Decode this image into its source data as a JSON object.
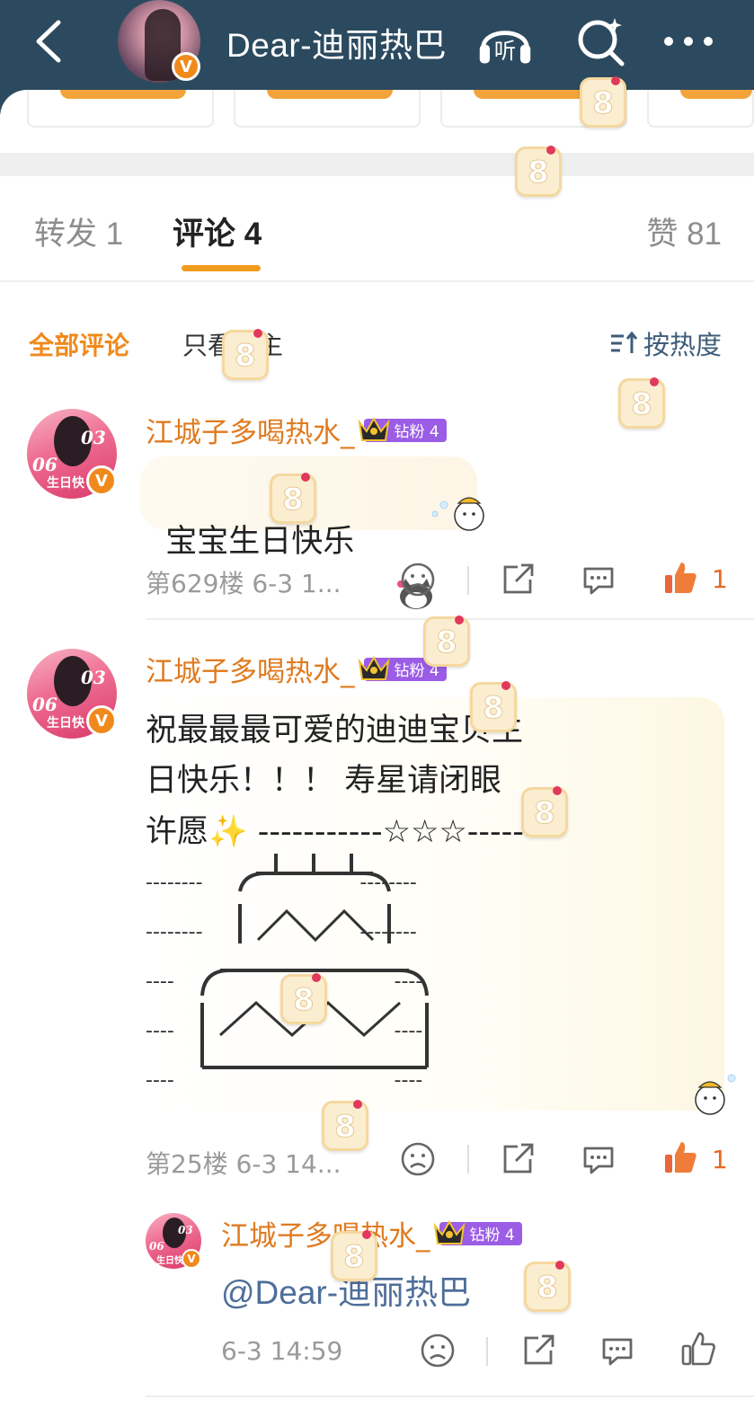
{
  "header": {
    "title": "Dear-迪丽热巴",
    "listen_label": "听"
  },
  "tabs": {
    "repost": "转发 1",
    "comment": "评论 4",
    "likes": "赞 81"
  },
  "filter": {
    "all": "全部评论",
    "op_only": "只看博主",
    "sort": "按热度"
  },
  "comments": [
    {
      "username": "江城子多喝热水_",
      "badge": "钻粉 4",
      "text": "宝宝生日快乐",
      "floor_time": "第629楼  6-3 1...",
      "like_count": "1"
    },
    {
      "username": "江城子多喝热水_",
      "badge": "钻粉 4",
      "text_lines": [
        "祝最最最可爱的迪迪宝贝生",
        "日快乐！！！ 寿星请闭眼",
        "许愿✨ -----------☆☆☆-----",
        "--------                         --------",
        "--------                         --------",
        "----                                   ----",
        "----                                   ----",
        "----                                   ----"
      ],
      "floor_time": "第25楼  6-3 14...",
      "like_count": "1"
    }
  ],
  "reply": {
    "username": "江城子多喝热水_",
    "badge": "钻粉 4",
    "text": "@Dear-迪丽热巴",
    "time": "6-3 14:59"
  },
  "avatar_text": {
    "top": "03",
    "bottom": "06",
    "caption": "生日快"
  },
  "colors": {
    "header_bg": "#2c4a5f",
    "accent_orange": "#f08a1c",
    "username": "#e07a1e",
    "fan_badge": "#9b5de5",
    "link": "#4e6e9a"
  }
}
